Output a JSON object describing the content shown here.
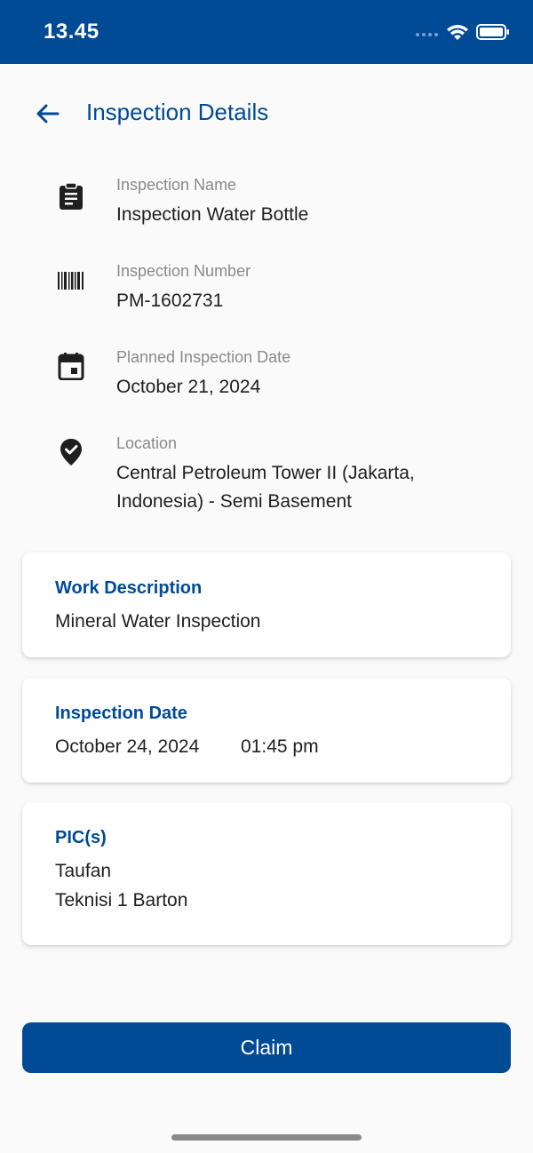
{
  "status_bar": {
    "time": "13.45",
    "signal_icon": "signal-dots-icon",
    "wifi_icon": "wifi-icon",
    "battery_icon": "battery-icon"
  },
  "header": {
    "back_icon": "arrow-left-icon",
    "title": "Inspection Details"
  },
  "details": {
    "inspection_name": {
      "icon": "clipboard-icon",
      "label": "Inspection Name",
      "value": "Inspection Water Bottle"
    },
    "inspection_number": {
      "icon": "barcode-icon",
      "label": "Inspection Number",
      "value": "PM-1602731"
    },
    "planned_date": {
      "icon": "calendar-icon",
      "label": "Planned Inspection Date",
      "value": "October 21, 2024"
    },
    "location": {
      "icon": "location-check-icon",
      "label": "Location",
      "value": "Central Petroleum Tower II (Jakarta, Indonesia) - Semi Basement"
    }
  },
  "work_description": {
    "title": "Work Description",
    "text": "Mineral Water Inspection"
  },
  "inspection_date": {
    "title": "Inspection Date",
    "date": "October 24, 2024",
    "time": "01:45 pm"
  },
  "pics": {
    "title": "PIC(s)",
    "names": [
      "Taufan",
      "Teknisi 1 Barton"
    ]
  },
  "actions": {
    "claim_label": "Claim"
  },
  "colors": {
    "primary": "#004a96",
    "label": "#8a8a8a",
    "text": "#1f1f1f",
    "background": "#fafafa"
  }
}
